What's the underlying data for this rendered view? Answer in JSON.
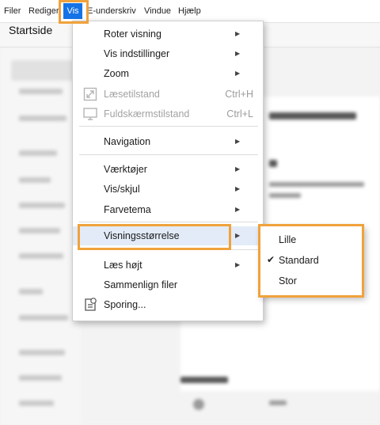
{
  "menubar": {
    "items": [
      "Filer",
      "Rediger",
      "Vis",
      "E-underskriv",
      "Vindue",
      "Hjælp"
    ],
    "active": "Vis"
  },
  "tab": {
    "label": "Startside"
  },
  "vis_menu": {
    "items": [
      {
        "label": "Roter visning",
        "has_submenu": true
      },
      {
        "label": "Vis indstillinger",
        "has_submenu": true
      },
      {
        "label": "Zoom",
        "has_submenu": true
      },
      {
        "label": "Læsetilstand",
        "shortcut": "Ctrl+H",
        "disabled": true,
        "icon": "read-mode-icon"
      },
      {
        "label": "Fuldskærmstilstand",
        "shortcut": "Ctrl+L",
        "disabled": true,
        "icon": "full-screen-icon"
      },
      {
        "label": "Navigation",
        "has_submenu": true
      },
      {
        "label": "Værktøjer",
        "has_submenu": true
      },
      {
        "label": "Vis/skjul",
        "has_submenu": true
      },
      {
        "label": "Farvetema",
        "has_submenu": true
      },
      {
        "label": "Visningsstørrelse",
        "has_submenu": true,
        "highlighted": true
      },
      {
        "label": "Læs højt",
        "has_submenu": true
      },
      {
        "label": "Sammenlign filer"
      },
      {
        "label": "Sporing...",
        "icon": "tracking-icon"
      }
    ]
  },
  "size_submenu": {
    "items": [
      {
        "label": "Lille",
        "checked": false
      },
      {
        "label": "Standard",
        "checked": true
      },
      {
        "label": "Stor",
        "checked": false
      }
    ]
  },
  "colors": {
    "menu_active": "#1473e6",
    "highlight": "#e2ebf7",
    "callout": "#f0a23c"
  }
}
